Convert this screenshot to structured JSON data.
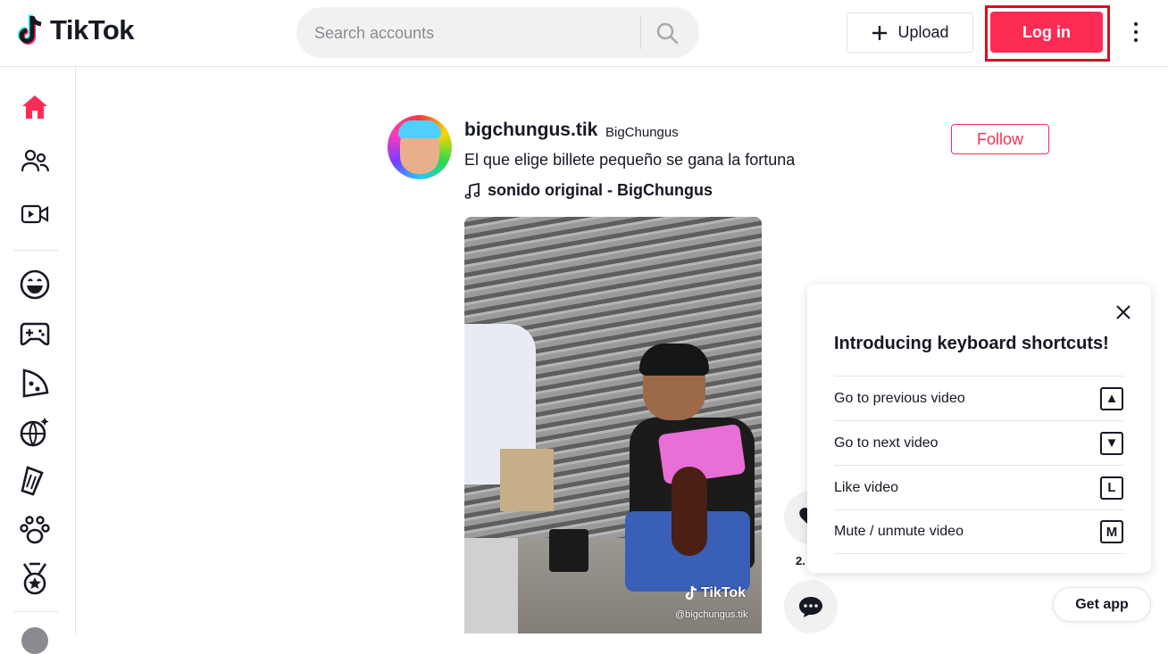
{
  "header": {
    "logo_text": "TikTok",
    "search_placeholder": "Search accounts",
    "upload_label": "Upload",
    "login_label": "Log in"
  },
  "sidebar": {
    "items": [
      {
        "icon": "home-icon",
        "active": true
      },
      {
        "icon": "following-icon"
      },
      {
        "icon": "live-icon"
      },
      {
        "icon": "comedy-icon"
      },
      {
        "icon": "gaming-icon"
      },
      {
        "icon": "food-icon"
      },
      {
        "icon": "dance-icon"
      },
      {
        "icon": "beauty-icon"
      },
      {
        "icon": "animals-icon"
      },
      {
        "icon": "sports-icon"
      }
    ]
  },
  "post": {
    "username": "bigchungus.tik",
    "nickname": "BigChungus",
    "caption": "El que elige billete pequeño se gana la fortuna",
    "music": "sonido original - BigChungus",
    "follow_label": "Follow",
    "watermark_brand": "TikTok",
    "watermark_handle": "@bigchungus.tik",
    "like_count": "2."
  },
  "shortcuts_panel": {
    "title": "Introducing keyboard shortcuts!",
    "rows": [
      {
        "label": "Go to previous video",
        "key": "▲"
      },
      {
        "label": "Go to next video",
        "key": "▼"
      },
      {
        "label": "Like video",
        "key": "L"
      },
      {
        "label": "Mute / unmute video",
        "key": "M"
      }
    ]
  },
  "get_app_label": "Get app",
  "colors": {
    "brand": "#fe2c55",
    "highlight_outline": "#e00a1d",
    "text": "#161823"
  }
}
